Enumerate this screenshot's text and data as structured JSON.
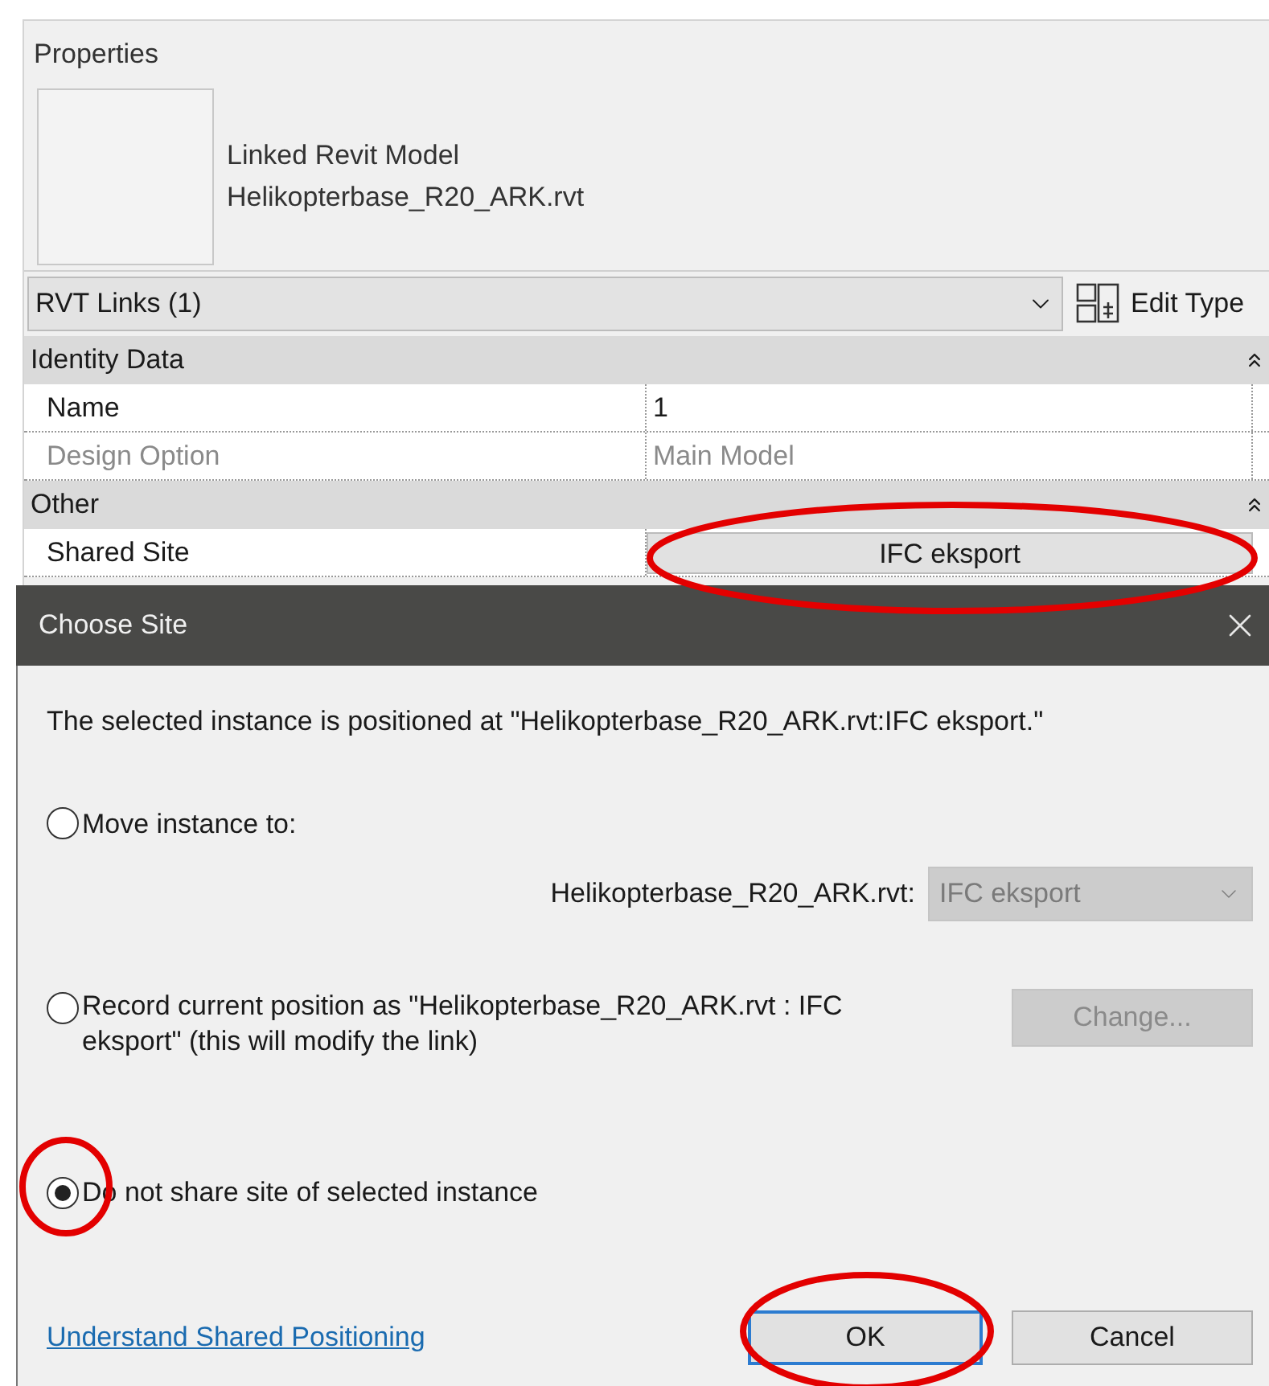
{
  "properties": {
    "title": "Properties",
    "type_lines": [
      "Linked Revit Model",
      "Helikopterbase_R20_ARK.rvt"
    ],
    "type_selector": "RVT Links (1)",
    "edit_type": "Edit Type",
    "groups": [
      {
        "title": "Identity Data",
        "expanded": true,
        "rows": [
          {
            "label": "Name",
            "value": "1",
            "kind": "text",
            "disabled": false
          },
          {
            "label": "Design Option",
            "value": "Main Model",
            "kind": "text",
            "disabled": true
          }
        ]
      },
      {
        "title": "Other",
        "expanded": true,
        "rows": [
          {
            "label": "Shared Site",
            "value": "IFC eksport",
            "kind": "button",
            "disabled": false
          }
        ]
      }
    ]
  },
  "dialog": {
    "title": "Choose Site",
    "message": "The selected instance is positioned at \"Helikopterbase_R20_ARK.rvt:IFC eksport.\"",
    "options": [
      {
        "label": "Move instance to:",
        "selected": false,
        "kind": "move"
      },
      {
        "label": "Record current position as \"Helikopterbase_R20_ARK.rvt : IFC eksport\" (this will modify the link)",
        "selected": false,
        "kind": "record"
      },
      {
        "label": "Do not share site of selected instance",
        "selected": true,
        "kind": "plain"
      }
    ],
    "move_target_label": "Helikopterbase_R20_ARK.rvt:",
    "move_target_value": "IFC eksport",
    "move_target_disabled": true,
    "change_button": "Change...",
    "change_disabled": true,
    "link": "Understand Shared Positioning",
    "ok": "OK",
    "cancel": "Cancel"
  }
}
